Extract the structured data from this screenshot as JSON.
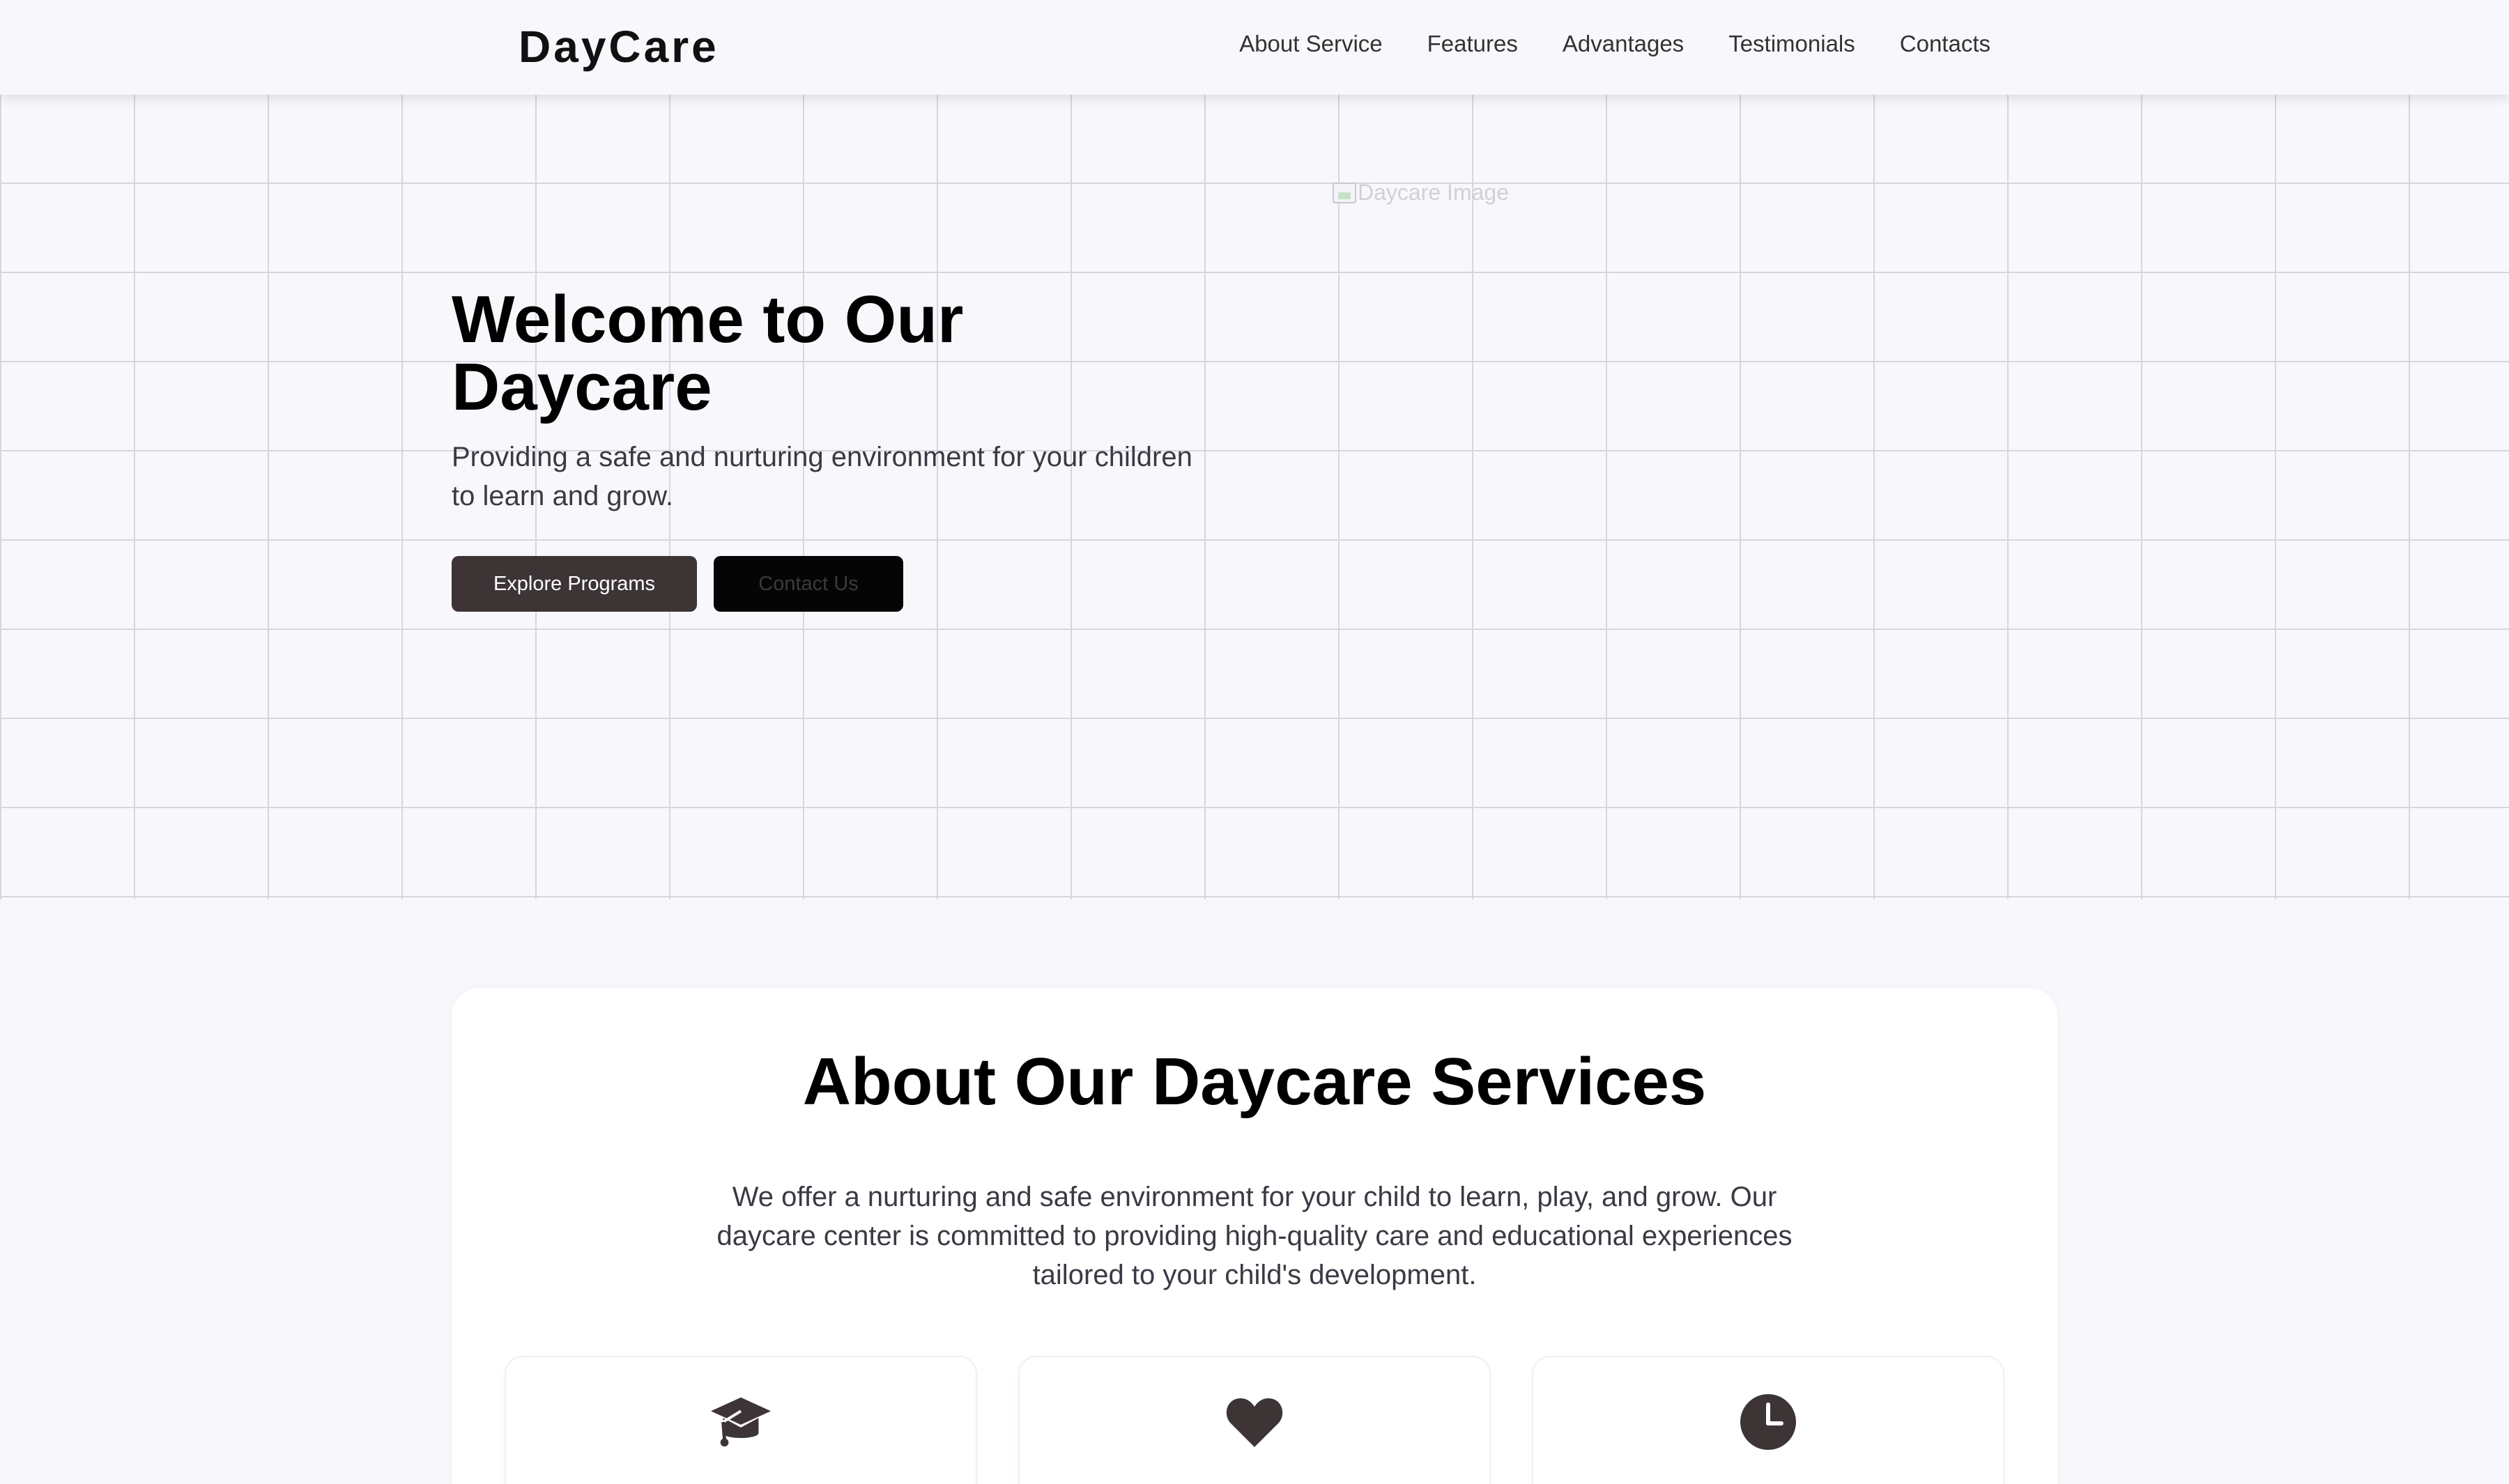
{
  "brand": "DayCare",
  "nav": {
    "items": [
      "About Service",
      "Features",
      "Advantages",
      "Testimonials",
      "Contacts"
    ]
  },
  "hero": {
    "title": "Welcome to Our Daycare",
    "subtitle": "Providing a safe and nurturing environment for your children to learn and grow.",
    "explore_label": "Explore Programs",
    "contact_label": "Contact Us",
    "image_alt": "Daycare Image"
  },
  "about": {
    "title": "About Our Daycare Services",
    "text": "We offer a nurturing and safe environment for your child to learn, play, and grow. Our daycare center is committed to providing high-quality care and educational experiences tailored to your child's development.",
    "features": [
      {
        "icon": "graduation-cap-icon"
      },
      {
        "icon": "heart-icon"
      },
      {
        "icon": "clock-icon"
      }
    ]
  },
  "colors": {
    "page_bg": "#f8f8fc",
    "icon_dark": "#3d3436",
    "button_dark": "#3d3436",
    "button_black": "#050505"
  }
}
